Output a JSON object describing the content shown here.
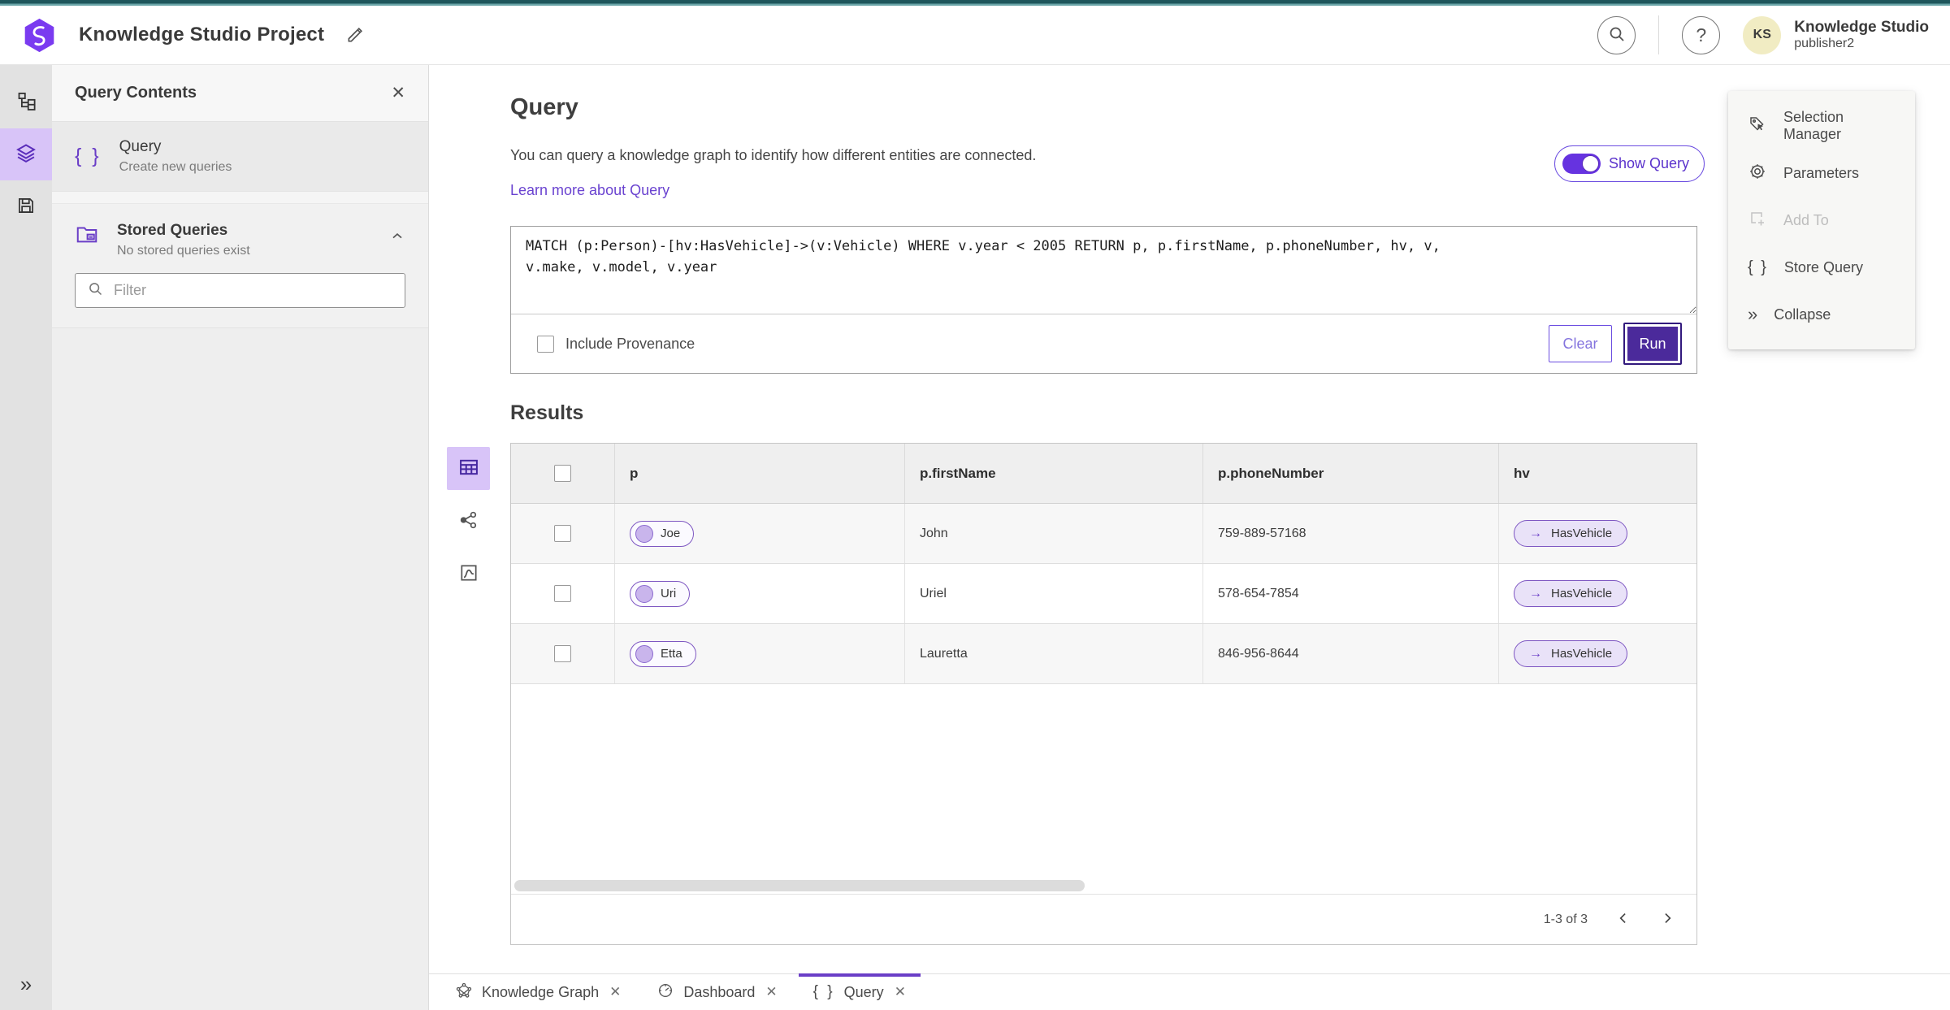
{
  "colors": {
    "accent_purple": "#6a3ec7",
    "deep_purple_button": "#4b2a9b",
    "lavender_selected": "#d8c4f8",
    "teal_topbar": "#1e565b",
    "link_purple": "#6a43d0",
    "chip_border": "#7e57c2",
    "avatar_bg": "#f1ecc3"
  },
  "icons": {
    "close": "✕",
    "braces": "{ }",
    "arrow_right": "→",
    "collapse": "»",
    "expand": "»"
  },
  "header": {
    "title": "Knowledge Studio Project",
    "user_initials": "KS",
    "user_name": "Knowledge Studio",
    "user_role": "publisher2"
  },
  "sidebar": {
    "panel_title": "Query Contents",
    "query_item": {
      "title": "Query",
      "subtitle": "Create new queries"
    },
    "stored": {
      "title": "Stored Queries",
      "subtitle": "No stored queries exist"
    },
    "filter_placeholder": "Filter"
  },
  "query": {
    "title": "Query",
    "description": "You can query a knowledge graph to identify how different entities are connected.",
    "link": "Learn more about Query",
    "show_query_label": "Show Query",
    "query_text": "MATCH (p:Person)-[hv:HasVehicle]->(v:Vehicle) WHERE v.year < 2005 RETURN p, p.firstName, p.phoneNumber, hv, v,\nv.make, v.model, v.year",
    "include_provenance_label": "Include Provenance",
    "clear_label": "Clear",
    "run_label": "Run"
  },
  "results": {
    "title": "Results",
    "columns": {
      "p": "p",
      "firstName": "p.firstName",
      "phone": "p.phoneNumber",
      "hv": "hv"
    },
    "rows": [
      {
        "p": "Joe",
        "firstName": "John",
        "phone": "759-889-57168",
        "hv": "HasVehicle"
      },
      {
        "p": "Uri",
        "firstName": "Uriel",
        "phone": "578-654-7854",
        "hv": "HasVehicle"
      },
      {
        "p": "Etta",
        "firstName": "Lauretta",
        "phone": "846-956-8644",
        "hv": "HasVehicle"
      }
    ],
    "pagination": "1-3 of 3"
  },
  "right_panel": {
    "selection_manager": "Selection Manager",
    "parameters": "Parameters",
    "add_to": "Add To",
    "store_query": "Store Query",
    "collapse": "Collapse"
  },
  "tabs": {
    "knowledge_graph": "Knowledge Graph",
    "dashboard": "Dashboard",
    "query": "Query"
  }
}
